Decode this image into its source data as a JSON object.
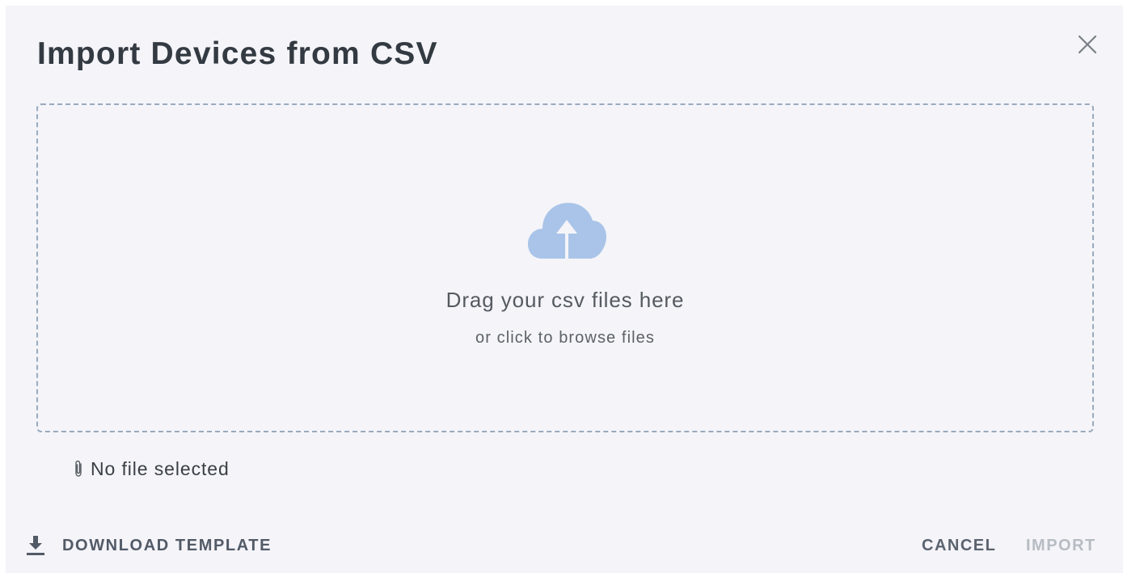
{
  "dialog": {
    "title": "Import Devices from CSV",
    "close_icon": "close-icon"
  },
  "dropzone": {
    "icon": "cloud-upload-icon",
    "primary_text": "Drag your csv files here",
    "secondary_text": "or click to browse files",
    "icon_color": "#a9c4e8",
    "border_color": "#9aaabd"
  },
  "file_status": {
    "icon": "paperclip-icon",
    "text": "No file selected"
  },
  "actions": {
    "download_icon": "download-icon",
    "download_label": "DOWNLOAD TEMPLATE",
    "cancel_label": "CANCEL",
    "import_label": "IMPORT",
    "import_disabled": true
  },
  "colors": {
    "dialog_background": "#f4f4f9",
    "title": "#333a42",
    "disabled_text": "#b7bcc3"
  }
}
